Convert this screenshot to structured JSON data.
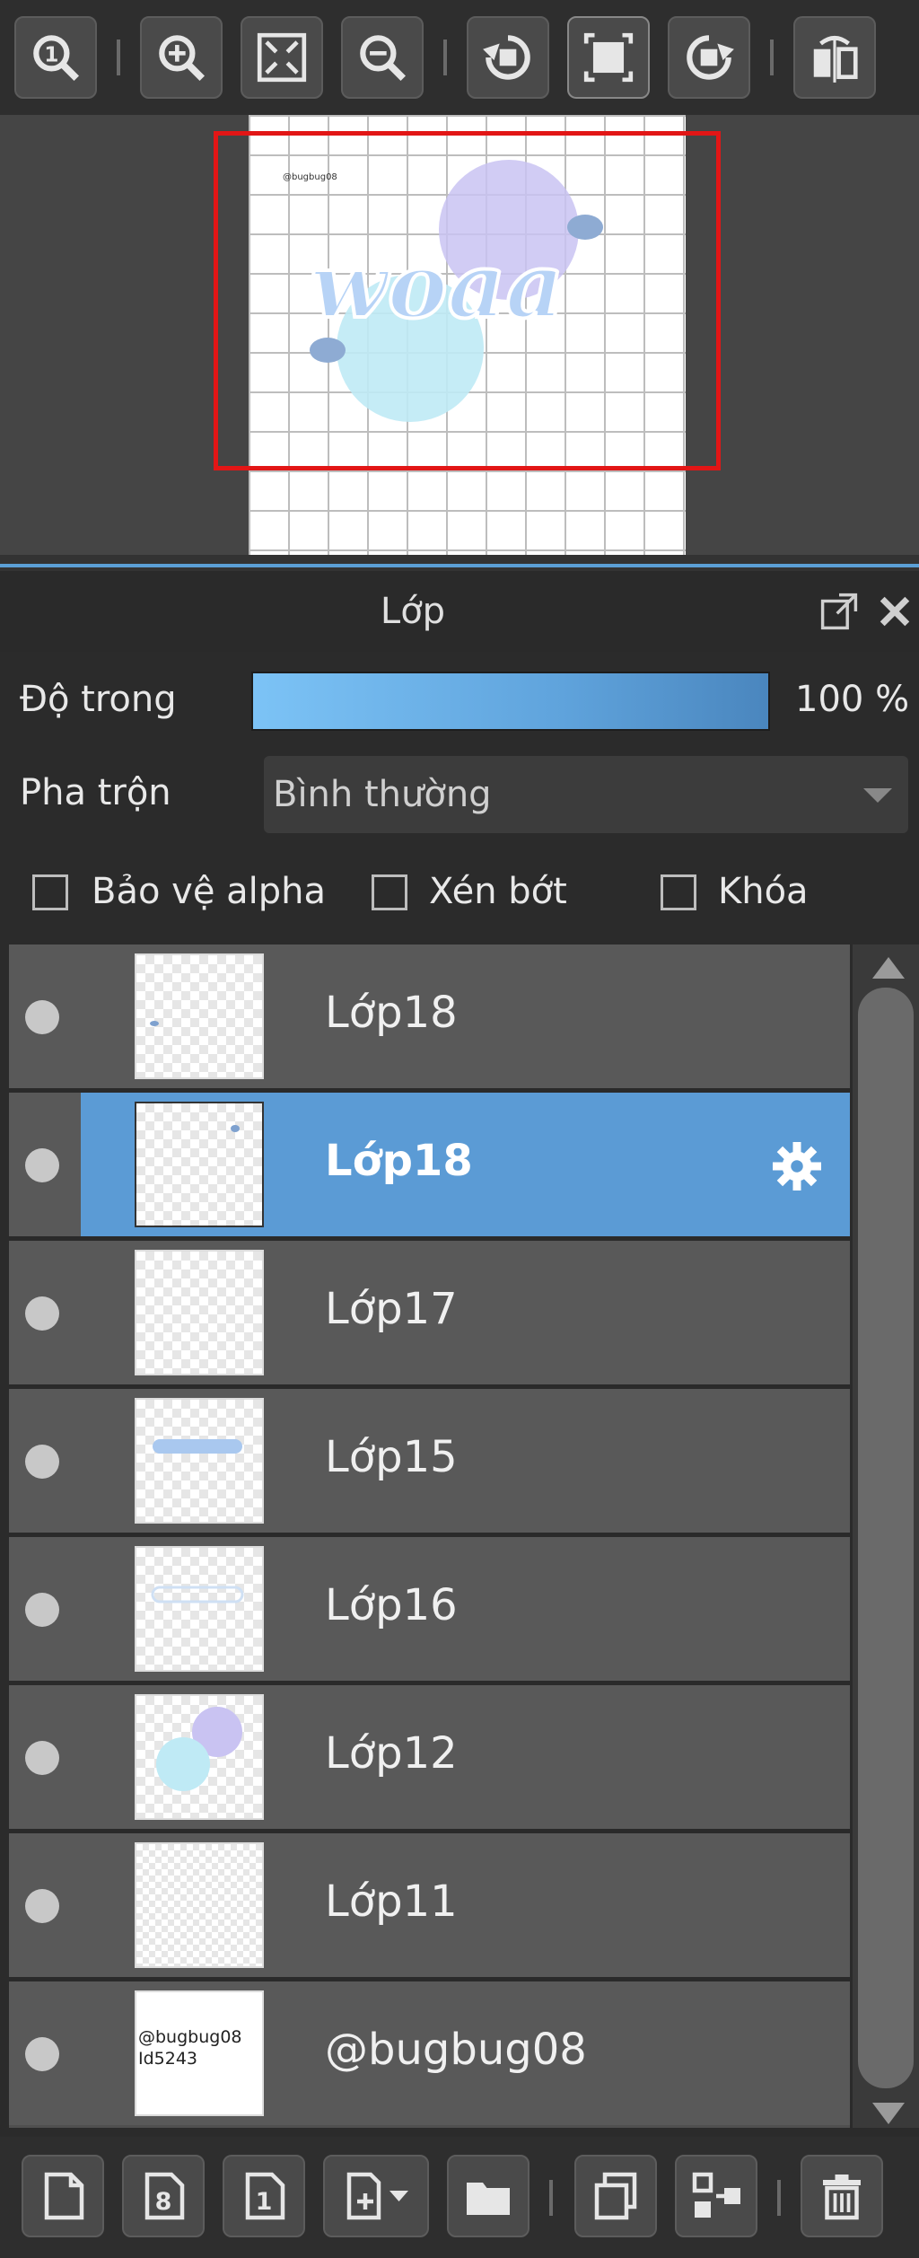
{
  "toolbar": {
    "icons": [
      "zoom-actual-icon",
      "zoom-in-icon",
      "fit-screen-icon",
      "zoom-out-icon",
      "rotate-left-icon",
      "reset-rotation-icon",
      "rotate-right-icon",
      "flip-horizontal-icon"
    ]
  },
  "navigator": {
    "preview_text": "woaa",
    "preview_credit": "@bugbug08"
  },
  "panel": {
    "title": "Lớp"
  },
  "properties": {
    "opacity_label": "Độ trong",
    "opacity_value": "100 %",
    "opacity_fraction": 1.0,
    "blend_label": "Pha trộn",
    "blend_value": "Bình thường",
    "alpha_protect_label": "Bảo vệ alpha",
    "clipping_label": "Xén bớt",
    "lock_label": "Khóa"
  },
  "layers": [
    {
      "name": "Lớp18",
      "selected": false
    },
    {
      "name": "Lớp18",
      "selected": true
    },
    {
      "name": "Lớp17",
      "selected": false
    },
    {
      "name": "Lớp15",
      "selected": false
    },
    {
      "name": "Lớp16",
      "selected": false
    },
    {
      "name": "Lớp12",
      "selected": false
    },
    {
      "name": "Lớp11",
      "selected": false
    },
    {
      "name": "@bugbug08",
      "selected": false
    }
  ],
  "bottom_toolbar": {
    "icons": [
      "new-layer-icon",
      "new-8bit-layer-icon",
      "new-1bit-layer-icon",
      "add-layer-menu-icon",
      "new-folder-icon",
      "duplicate-layer-icon",
      "merge-down-icon",
      "delete-layer-icon"
    ]
  },
  "thumbnail_texts": {
    "credit_line1": "@bugbug08",
    "credit_line2": "Id5243"
  }
}
